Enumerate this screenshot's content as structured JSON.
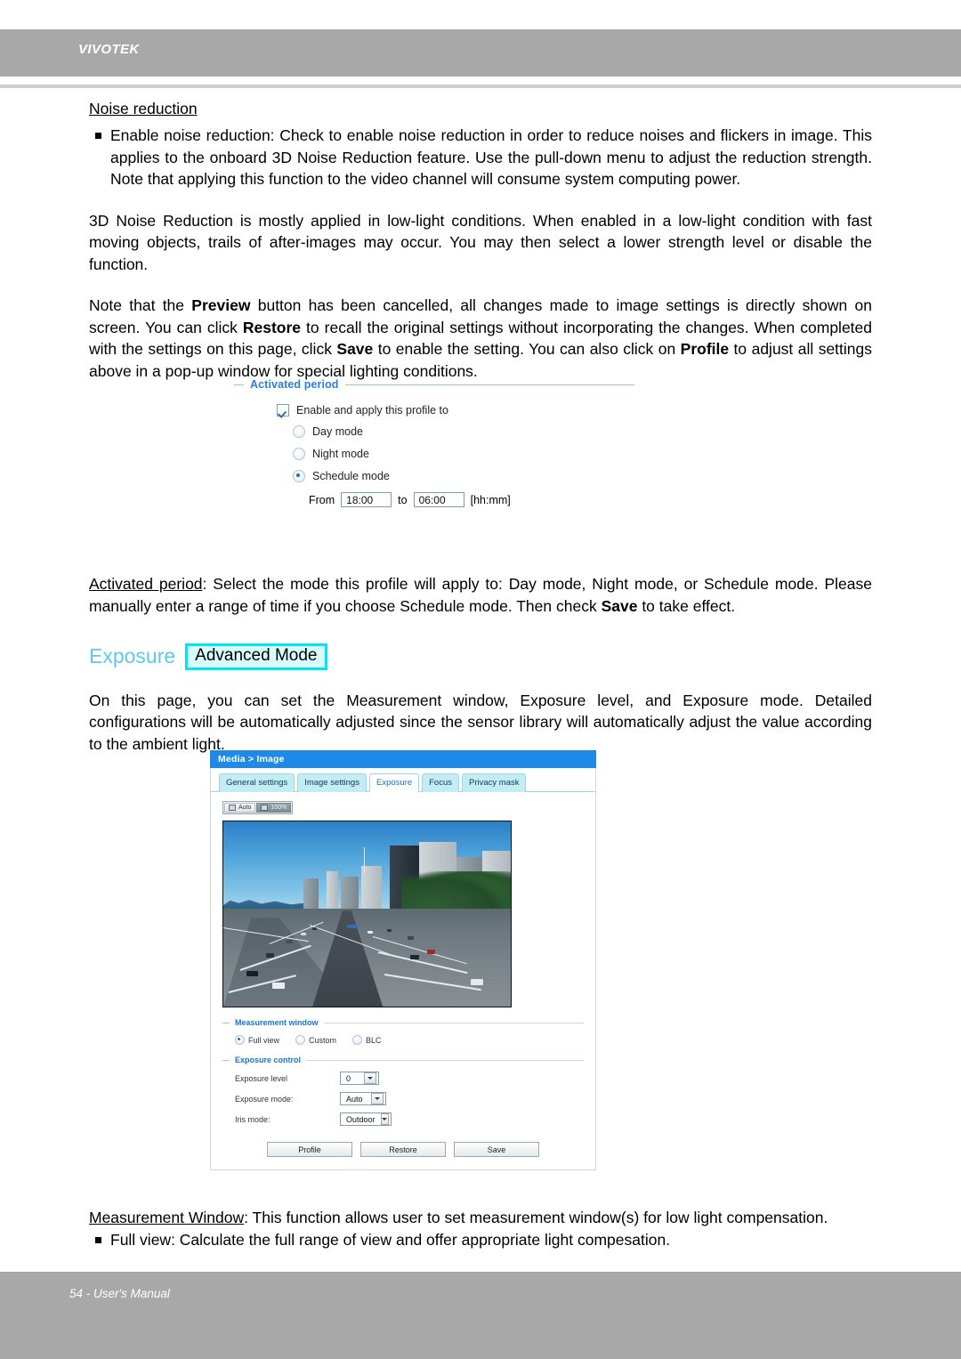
{
  "header": {
    "brand": "VIVOTEK"
  },
  "footer": {
    "text": "54 - User's Manual"
  },
  "sections": {
    "noise_reduction": {
      "heading": "Noise reduction",
      "bullet1_lead": "Enable noise reduction:",
      "bullet1": "Enable noise reduction: Check to enable noise reduction in order to reduce noises and flickers in image. This applies to the onboard 3D Noise Reduction feature. Use the pull-down menu to adjust the reduction strength. Note that applying this function to the video channel will consume system computing power.",
      "para2": "3D Noise Reduction is mostly applied in low-light conditions. When enabled in a low-light condition with fast moving objects, trails of after-images may occur. You may then select a lower strength level or disable the function."
    },
    "preview_note": {
      "t1": "Note that the ",
      "b1": "Preview",
      "t2": " button has been cancelled, all changes made to image settings is directly shown on screen. You can click ",
      "b2": "Restore",
      "t3": " to recall the original settings without incorporating the changes. When completed with the settings on this page, click ",
      "b3": "Save",
      "t4": " to enable the setting. You can also click on ",
      "b4": "Profile",
      "t5": " to adjust all settings above in a pop-up window for special lighting conditions."
    },
    "activated_period_desc": {
      "term": "Activated period",
      "t1": ": Select the mode this profile will apply to: Day mode, Night mode, or Schedule mode. Please manually enter a range of time if you choose Schedule mode. Then check ",
      "b1": "Save",
      "t2": " to take effect."
    },
    "exposure_heading": {
      "title": "Exposure",
      "badge": "Advanced Mode"
    },
    "exposure_intro": "On this page, you can set the Measurement window, Exposure level, and Exposure mode. Detailed configurations will be automatically adjusted since the sensor library will automatically adjust the value according to the ambient light.",
    "measurement_window_desc": {
      "term": "Measurement Window",
      "t1": ": This function allows user to set measurement window(s) for low light compensation."
    },
    "full_view_bullet": "Full view: Calculate the full range of view and offer appropriate light compesation."
  },
  "activated_period_widget": {
    "legend": "Activated period",
    "enable_label": "Enable and apply this profile to",
    "enable_checked": true,
    "modes": [
      {
        "label": "Day mode",
        "selected": false
      },
      {
        "label": "Night mode",
        "selected": false
      },
      {
        "label": "Schedule mode",
        "selected": true
      }
    ],
    "from_label": "From",
    "from_value": "18:00",
    "to_label": "to",
    "to_value": "06:00",
    "format_hint": "[hh:mm]"
  },
  "camera_ui": {
    "breadcrumb": "Media > Image",
    "tabs": [
      {
        "label": "General settings",
        "active": false
      },
      {
        "label": "Image settings",
        "active": false
      },
      {
        "label": "Exposure",
        "active": true
      },
      {
        "label": "Focus",
        "active": false
      },
      {
        "label": "Privacy mask",
        "active": false
      }
    ],
    "video_toolbar": [
      {
        "label": "Auto",
        "active": false
      },
      {
        "label": "100%",
        "active": true
      }
    ],
    "measurement_window": {
      "legend": "Measurement window",
      "options": [
        {
          "label": "Full view",
          "selected": true
        },
        {
          "label": "Custom",
          "selected": false
        },
        {
          "label": "BLC",
          "selected": false
        }
      ]
    },
    "exposure_control": {
      "legend": "Exposure control",
      "fields": [
        {
          "label": "Exposure level",
          "value": "0"
        },
        {
          "label": "Exposure mode:",
          "value": "Auto"
        },
        {
          "label": "Iris mode:",
          "value": "Outdoor"
        }
      ]
    },
    "buttons": [
      {
        "label": "Profile"
      },
      {
        "label": "Restore"
      },
      {
        "label": "Save"
      }
    ]
  },
  "colors": {
    "header_gray": "#a8a8a8",
    "accent_blue": "#1e8ae8",
    "exposure_cyan": "#5ec8f2",
    "badge_border": "#00e5f5",
    "legend_blue": "#1775c4"
  }
}
